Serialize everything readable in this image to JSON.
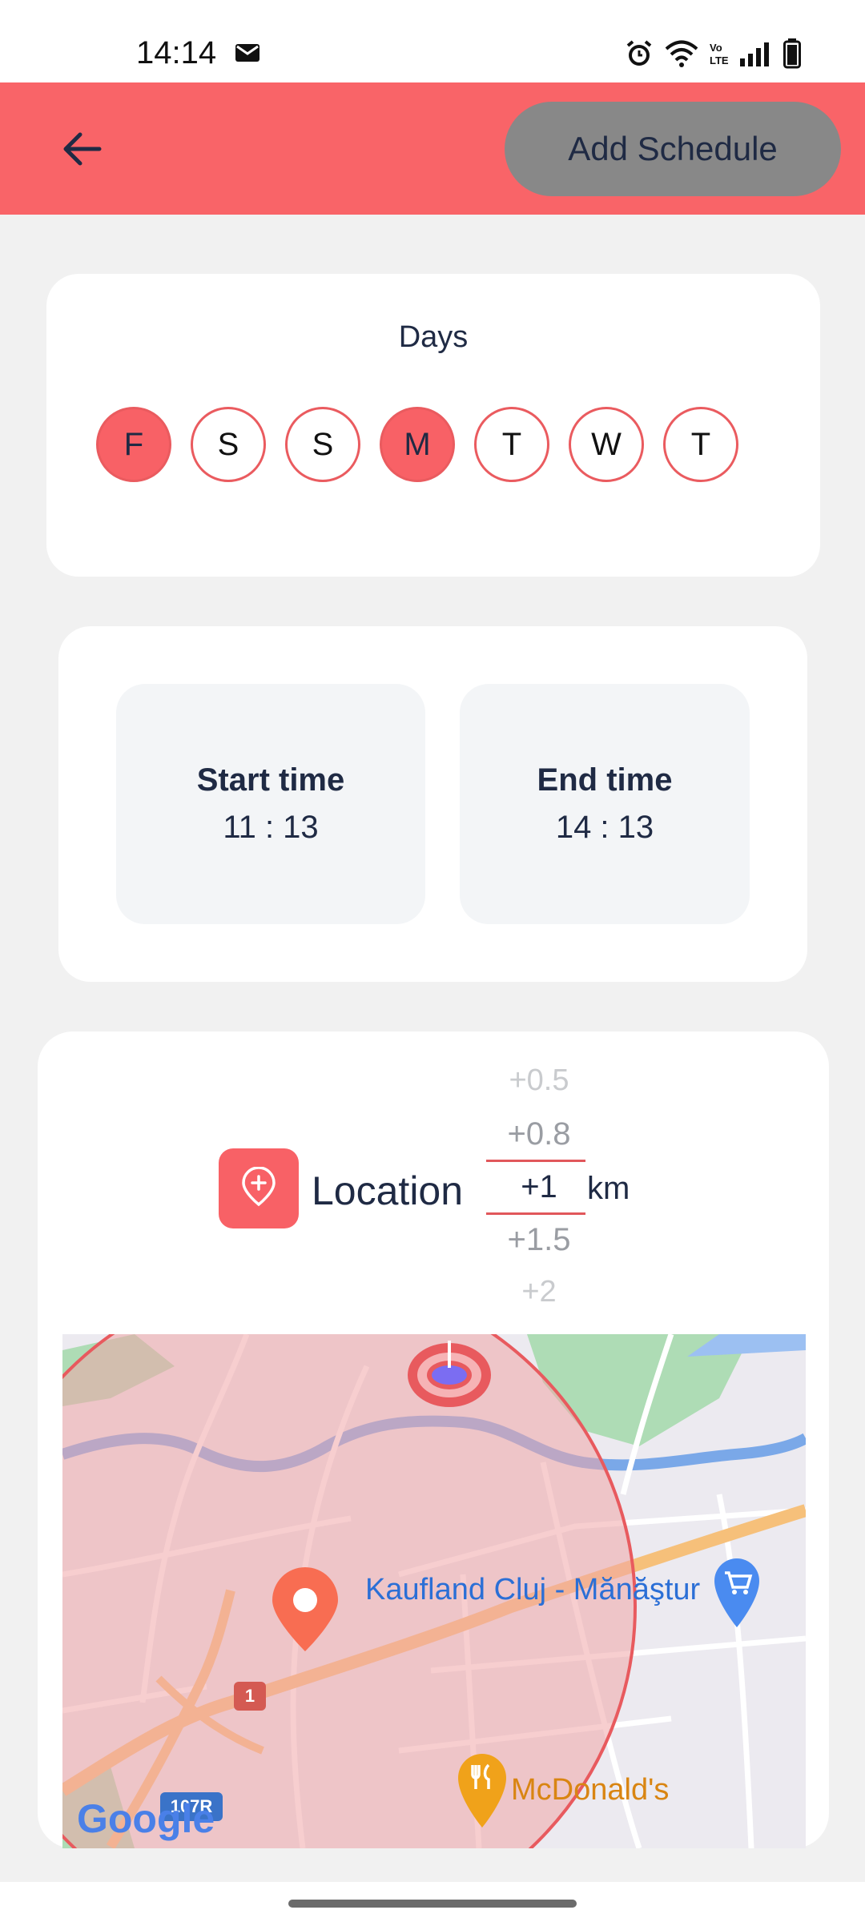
{
  "status_bar": {
    "time": "14:14",
    "icons": [
      "mail-icon",
      "alarm-icon",
      "wifi-icon",
      "volte-icon",
      "signal-icon",
      "battery-icon"
    ]
  },
  "app_bar": {
    "back_icon": "arrow-left-icon",
    "add_schedule_label": "Add Schedule"
  },
  "days": {
    "title": "Days",
    "items": [
      {
        "label": "F",
        "selected": true
      },
      {
        "label": "S",
        "selected": false
      },
      {
        "label": "S",
        "selected": false
      },
      {
        "label": "M",
        "selected": true
      },
      {
        "label": "T",
        "selected": false
      },
      {
        "label": "W",
        "selected": false
      },
      {
        "label": "T",
        "selected": false
      }
    ]
  },
  "times": {
    "start_label": "Start time",
    "start_value": "11 : 13",
    "end_label": "End time",
    "end_value": "14 : 13"
  },
  "location": {
    "label": "Location",
    "radius_options": [
      "+0.5",
      "+0.8",
      "+1",
      "+1.5",
      "+2"
    ],
    "radius_selected": "+1",
    "unit": "km"
  },
  "map": {
    "places": [
      {
        "name": "Kaufland Cluj - Mănăştur",
        "type": "shopping-cart-icon"
      },
      {
        "name": "McDonald's",
        "type": "restaurant-icon"
      }
    ],
    "road_labels": [
      "1",
      "107R"
    ],
    "attribution": "Google"
  },
  "colors": {
    "accent": "#F96468",
    "button_gray": "#888888",
    "text_dark": "#1F2A44"
  }
}
